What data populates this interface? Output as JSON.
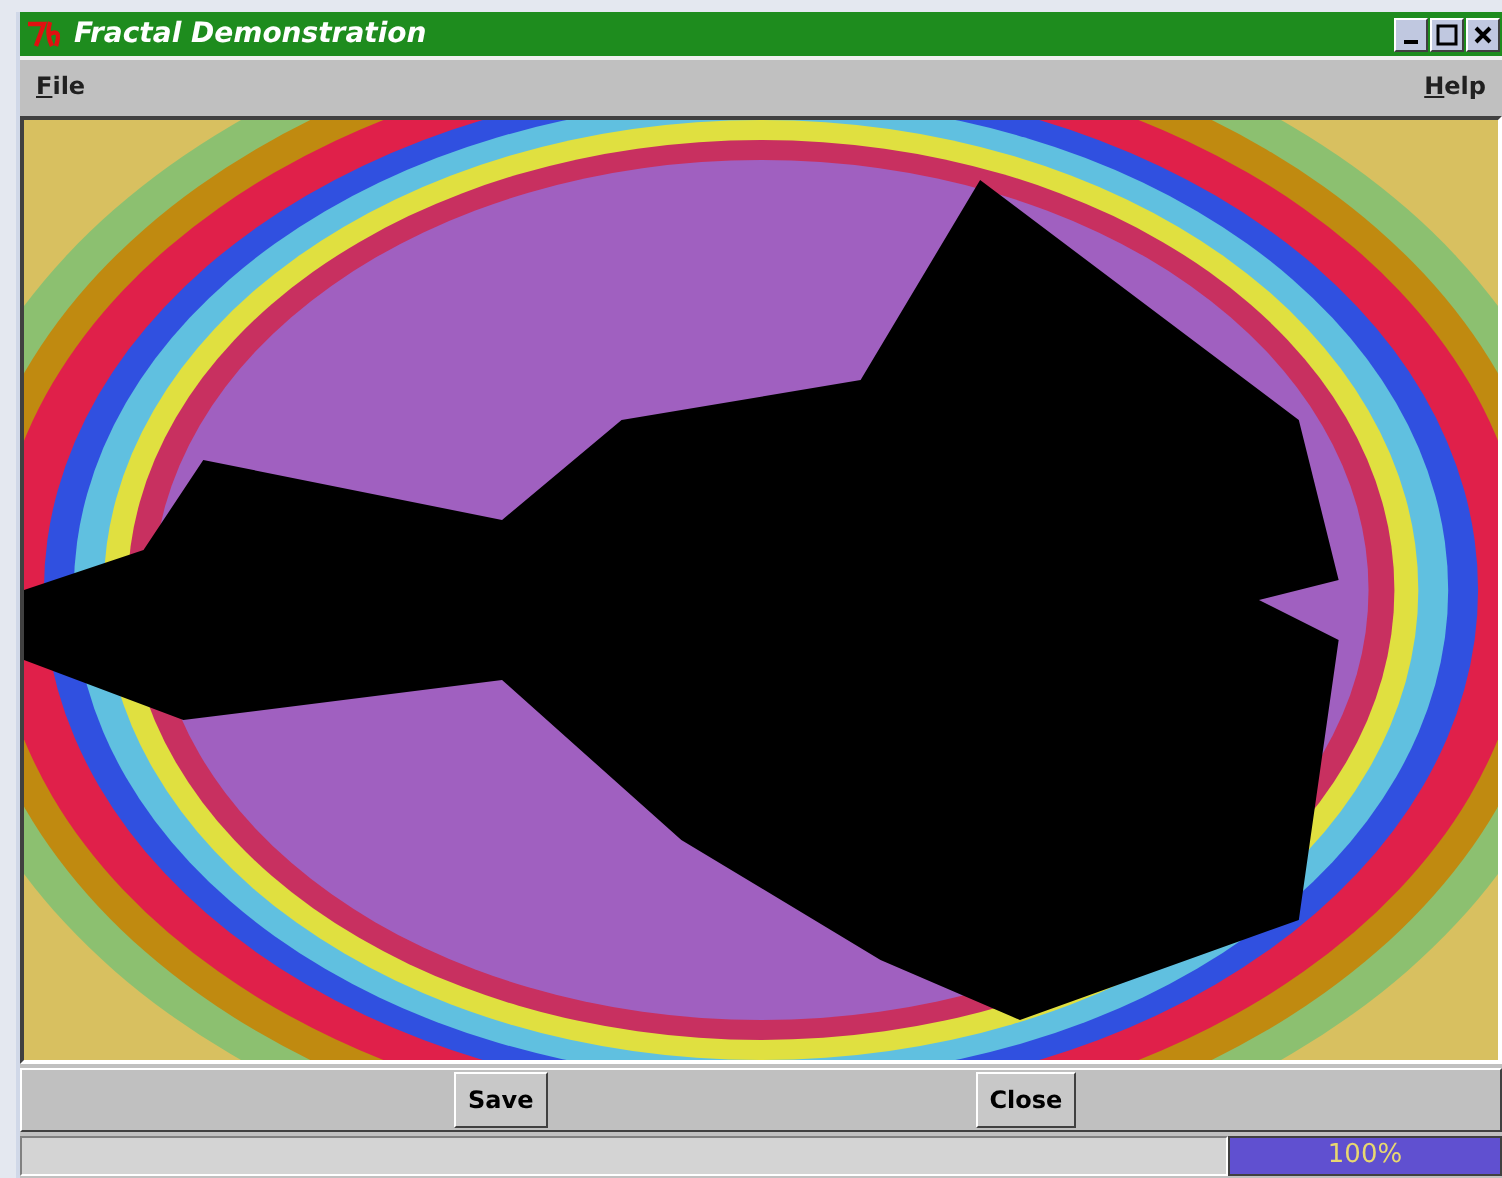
{
  "window": {
    "title": "Fractal Demonstration"
  },
  "menu": [
    {
      "label": "File"
    },
    {
      "label": "Help"
    }
  ],
  "buttons": [
    {
      "label": "Save"
    },
    {
      "label": "Close"
    }
  ],
  "status_bar": {
    "progress": {
      "level": 1.0,
      "reading": "100%"
    }
  }
}
